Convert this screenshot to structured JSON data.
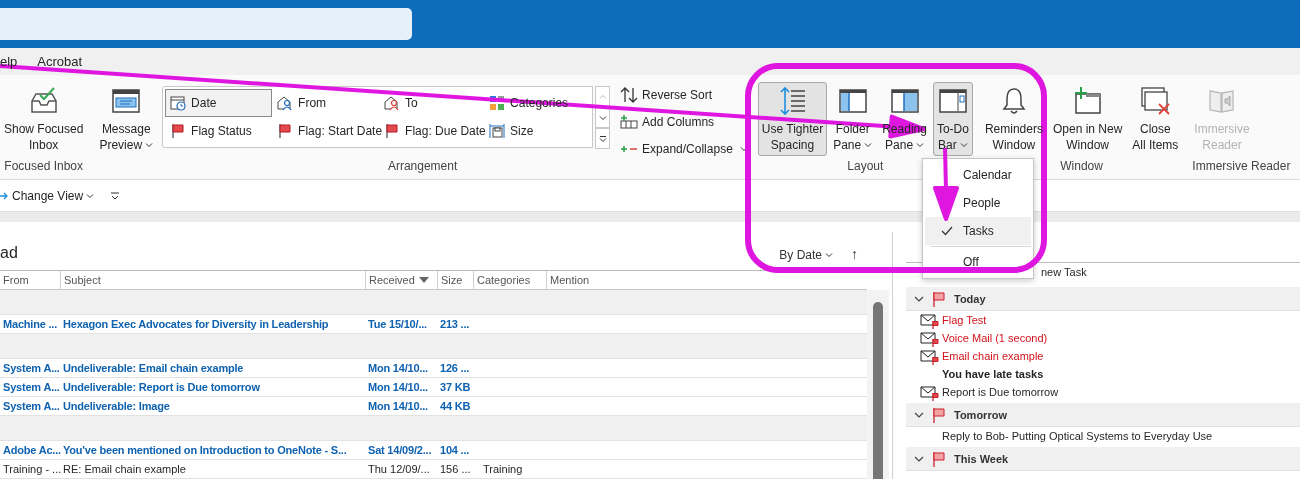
{
  "menu_tabs": [
    "elp",
    "Acrobat"
  ],
  "ribbon": {
    "groups": [
      {
        "label": "Focused Inbox",
        "buttons": [
          {
            "lines": [
              "Show Focused",
              "Inbox"
            ],
            "dropdown": false,
            "pressed": false,
            "disabled": false
          }
        ]
      },
      {
        "label": "Arrangement",
        "buttons": [
          {
            "lines": [
              "Message",
              "Preview"
            ],
            "dropdown": true,
            "pressed": false,
            "disabled": false
          }
        ],
        "gallery": [
          {
            "label": "Date",
            "selected": true
          },
          {
            "label": "From",
            "selected": false
          },
          {
            "label": "To",
            "selected": false
          },
          {
            "label": "Categories",
            "selected": false
          },
          {
            "label": "Flag Status",
            "selected": false
          },
          {
            "label": "Flag: Start Date",
            "selected": false
          },
          {
            "label": "Flag: Due Date",
            "selected": false
          },
          {
            "label": "Size",
            "selected": false
          }
        ],
        "side_buttons": [
          {
            "label": "Reverse Sort",
            "dropdown": false
          },
          {
            "label": "Add Columns",
            "dropdown": false
          },
          {
            "label": "Expand/Collapse",
            "dropdown": true
          }
        ]
      },
      {
        "label": "Layout",
        "buttons": [
          {
            "lines": [
              "Use Tighter",
              "Spacing"
            ],
            "dropdown": false,
            "pressed": true,
            "disabled": false
          },
          {
            "lines": [
              "Folder",
              "Pane"
            ],
            "dropdown": true,
            "pressed": false,
            "disabled": false
          },
          {
            "lines": [
              "Reading",
              "Pane"
            ],
            "dropdown": true,
            "pressed": false,
            "disabled": false
          },
          {
            "lines": [
              "To-Do",
              "Bar"
            ],
            "dropdown": true,
            "pressed": true,
            "disabled": false
          }
        ]
      },
      {
        "label": "Window",
        "buttons": [
          {
            "lines": [
              "Reminders",
              "Window"
            ],
            "dropdown": false,
            "pressed": false,
            "disabled": false
          },
          {
            "lines": [
              "Open in New",
              "Window"
            ],
            "dropdown": false,
            "pressed": false,
            "disabled": false
          },
          {
            "lines": [
              "Close",
              "All Items"
            ],
            "dropdown": false,
            "pressed": false,
            "disabled": false
          }
        ]
      },
      {
        "label": "Immersive Reader",
        "buttons": [
          {
            "lines": [
              "Immersive",
              "Reader"
            ],
            "dropdown": false,
            "pressed": false,
            "disabled": true
          }
        ]
      }
    ]
  },
  "view_bar": {
    "change_view": "Change View"
  },
  "todo_menu": [
    {
      "label": "Calendar",
      "checked": false
    },
    {
      "label": "People",
      "checked": false
    },
    {
      "label": "Tasks",
      "checked": true
    },
    {
      "label": "Off",
      "checked": false
    }
  ],
  "message_list": {
    "title": "ad",
    "sort": "By Date",
    "sort_direction": "↑",
    "columns": [
      {
        "label": "From",
        "sorted": false
      },
      {
        "label": "Subject",
        "sorted": false
      },
      {
        "label": "Received",
        "sorted": true
      },
      {
        "label": "Size",
        "sorted": false
      },
      {
        "label": "Categories",
        "sorted": false
      },
      {
        "label": "Mention",
        "sorted": false
      }
    ],
    "rows": [
      {
        "kind": "group"
      },
      {
        "kind": "message",
        "unread": true,
        "from": "Machine ...",
        "subject": "Hexagon Exec Advocates for Diversity in Leadership",
        "received": "Tue 15/10/...",
        "size": "213 ..."
      },
      {
        "kind": "group"
      },
      {
        "kind": "message",
        "unread": true,
        "from": "System A...",
        "subject": "Undeliverable: Email chain example",
        "received": "Mon 14/10...",
        "size": "126 ..."
      },
      {
        "kind": "message",
        "unread": true,
        "from": "System A...",
        "subject": "Undeliverable: Report is Due tomorrow",
        "received": "Mon 14/10...",
        "size": "37 KB"
      },
      {
        "kind": "message",
        "unread": true,
        "from": "System A...",
        "subject": "Undeliverable: Image",
        "received": "Mon 14/10...",
        "size": "44 KB"
      },
      {
        "kind": "group"
      },
      {
        "kind": "message",
        "unread": true,
        "from": "Adobe Ac...",
        "subject": "You've been mentioned on Introduction to OneNote - S...",
        "received": "Sat 14/09/2...",
        "size": "104 ..."
      },
      {
        "kind": "message",
        "unread": false,
        "from": "Training - ...",
        "subject": "RE: Email chain example",
        "received": "Thu 12/09/...",
        "size": "156 ...",
        "categories": "Training"
      }
    ]
  },
  "todo_bar": {
    "new_task_placeholder": "new Task",
    "groups": [
      {
        "label": "Today",
        "expanded": true,
        "items": [
          {
            "kind": "mail",
            "title": "Flag Test",
            "overdue": true
          },
          {
            "kind": "mail",
            "title": "Voice Mail (1 second)",
            "overdue": true
          },
          {
            "kind": "mail",
            "title": "Email chain example",
            "overdue": true
          },
          {
            "kind": "note",
            "title": "You have late tasks",
            "overdue": false
          },
          {
            "kind": "mail",
            "title": "Report is Due tomorrow",
            "overdue": false
          }
        ]
      },
      {
        "label": "Tomorrow",
        "expanded": true,
        "items": [
          {
            "kind": "task",
            "title": "Reply to Bob- Putting Optical Systems to Everyday Use",
            "overdue": false
          }
        ]
      },
      {
        "label": "This Week",
        "expanded": true
      }
    ]
  },
  "annotations": [
    {
      "kind": "arrow"
    },
    {
      "kind": "arrow"
    },
    {
      "kind": "frame"
    }
  ]
}
